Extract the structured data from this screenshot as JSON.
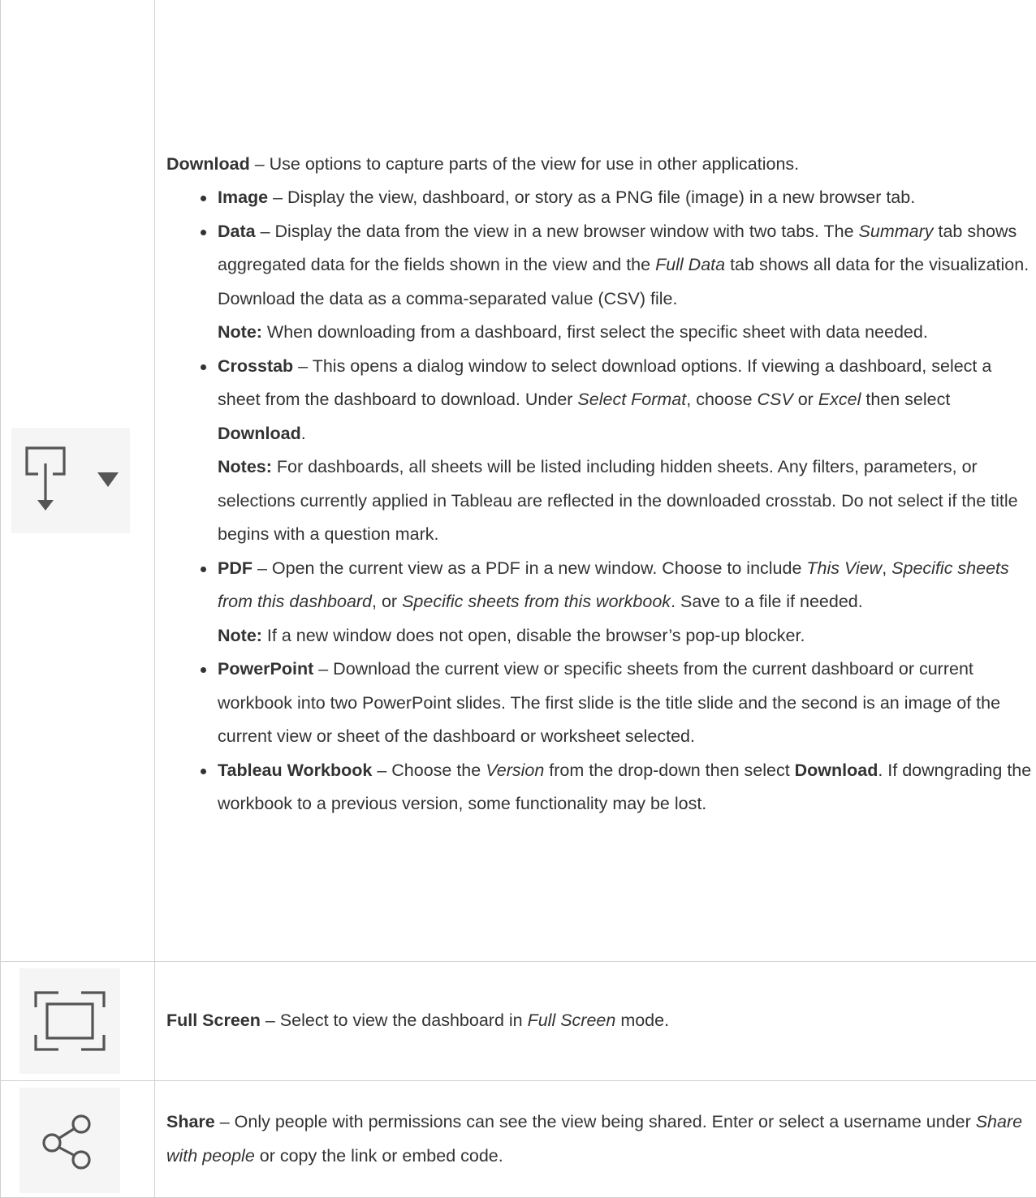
{
  "rows": {
    "download": {
      "icon": "download-dropdown-icon",
      "title": "Download",
      "intro": " – Use options to capture parts of the view for use in other applications.",
      "items": {
        "image": {
          "label": "Image",
          "text": " – Display the view, dashboard, or story as a PNG file (image) in a new browser tab."
        },
        "data": {
          "label": "Data",
          "t1": " – Display the data from the view in a new browser window with two tabs. The ",
          "i1": "Summary",
          "t2": " tab shows aggregated data for the fields shown in the view and the ",
          "i2": "Full Data",
          "t3": " tab shows all data for the visualization. Download the data as a comma-separated value (CSV) file.",
          "note_label": "Note:",
          "note_text": " When downloading from a dashboard, first select the specific sheet with data needed."
        },
        "crosstab": {
          "label": "Crosstab",
          "t1": " – This opens a dialog window to select download options. If viewing a dashboard, select a sheet from the dashboard to download. Under ",
          "i1": "Select Format",
          "t2": ", choose ",
          "i2": "CSV",
          "t3": " or ",
          "i3": "Excel",
          "t4": " then select ",
          "b1": "Download",
          "t5": ".",
          "note_label": "Notes:",
          "note_text": " For dashboards, all sheets will be listed including hidden sheets. Any filters, parameters, or selections currently applied in Tableau are reflected in the downloaded crosstab. Do not select if the title begins with a question mark."
        },
        "pdf": {
          "label": "PDF",
          "t1": " – Open the current view as a PDF in a new window. Choose to include ",
          "i1": "This View",
          "t2": ", ",
          "i2": "Specific sheets from this dashboard",
          "t3": ", or ",
          "i3": "Specific sheets from this workbook",
          "t4": ". Save to a file if needed.",
          "note_label": "Note:",
          "note_text": " If a new window does not open, disable the browser’s pop-up blocker."
        },
        "powerpoint": {
          "label": "PowerPoint",
          "text": " – Download the current view or specific sheets from the current dashboard or current workbook into two PowerPoint slides.  The first slide is the title slide and the second is an image of the current view or sheet of the dashboard or worksheet selected."
        },
        "workbook": {
          "label": "Tableau Workbook",
          "t1": " – Choose the ",
          "i1": "Version",
          "t2": " from the drop-down then select ",
          "b1": "Download",
          "t3": ". If downgrading the workbook to a previous version, some functionality may be lost."
        }
      }
    },
    "fullscreen": {
      "icon": "full-screen-icon",
      "title": "Full Screen",
      "t1": " – Select to view the dashboard in ",
      "i1": "Full Screen",
      "t2": " mode."
    },
    "share": {
      "icon": "share-icon",
      "title": "Share",
      "t1": " – Only people with permissions can see the view being shared. Enter or select a username under ",
      "i1": "Share with people",
      "t2": " or copy the link or embed code."
    }
  },
  "colors": {
    "text": "#333333",
    "border": "#d0d0d0",
    "icon_bg": "#f5f5f5",
    "icon_stroke": "#555555"
  }
}
